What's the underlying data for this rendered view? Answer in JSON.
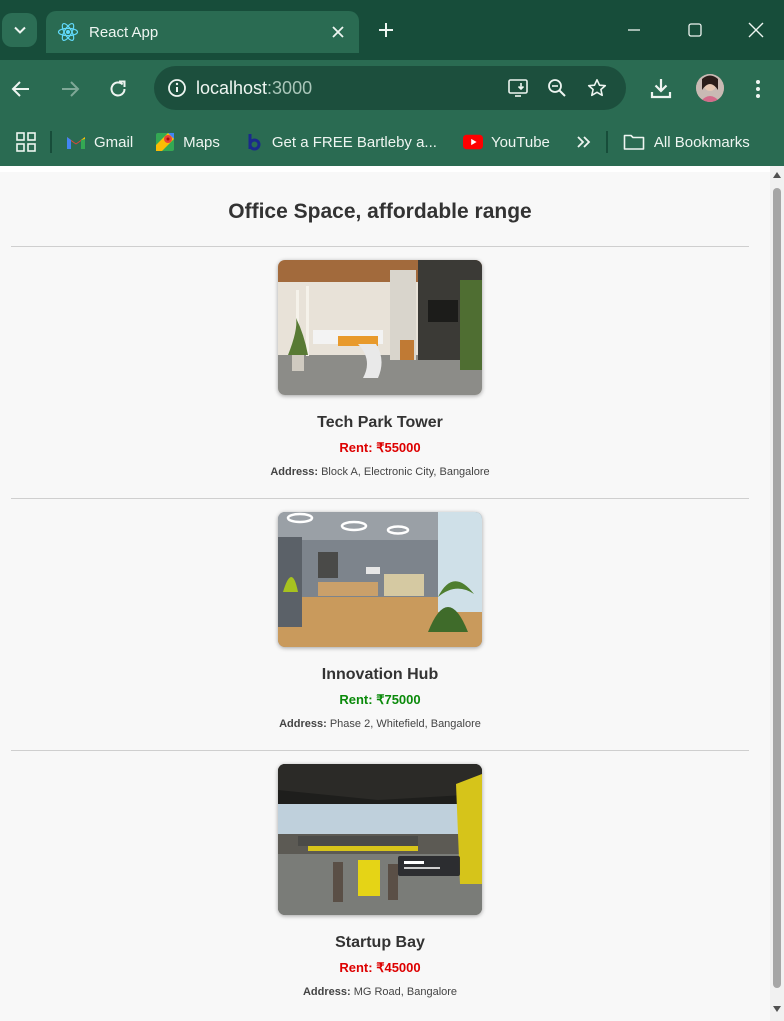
{
  "browser": {
    "tab_title": "React App",
    "url_host": "localhost",
    "url_port": ":3000"
  },
  "bookmarks": [
    {
      "label": "Gmail",
      "icon": "gmail-icon"
    },
    {
      "label": "Maps",
      "icon": "maps-icon"
    },
    {
      "label": "Get a FREE Bartleby a...",
      "icon": "bartleby-icon"
    },
    {
      "label": "YouTube",
      "icon": "youtube-icon"
    }
  ],
  "bookmarks_all": "All Bookmarks",
  "page": {
    "heading": "Office Space, affordable range",
    "address_label": "Address:",
    "listings": [
      {
        "name": "Tech Park Tower",
        "rent": "Rent: ₹55000",
        "rent_color": "#dd0000",
        "address": "Block A, Electronic City, Bangalore"
      },
      {
        "name": "Innovation Hub",
        "rent": "Rent: ₹75000",
        "rent_color": "#0a8a0a",
        "address": "Phase 2, Whitefield, Bangalore"
      },
      {
        "name": "Startup Bay",
        "rent": "Rent: ₹45000",
        "rent_color": "#dd0000",
        "address": "MG Road, Bangalore"
      }
    ]
  }
}
